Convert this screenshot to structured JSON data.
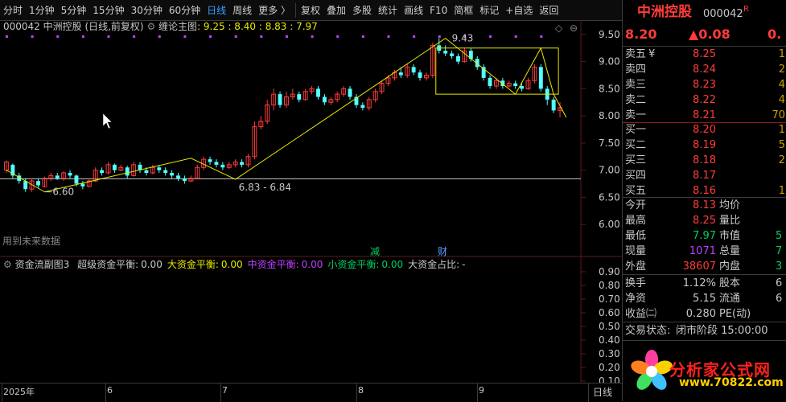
{
  "toolbar": {
    "items": [
      "分时",
      "1分钟",
      "5分钟",
      "15分钟",
      "30分钟",
      "60分钟",
      "日线",
      "周线",
      "更多 〉",
      "复权",
      "叠加",
      "多股",
      "统计",
      "画线",
      "F10",
      "简框",
      "标记",
      "+自选",
      "返回"
    ],
    "selected": "日线"
  },
  "main_legend": {
    "code_name": "000042 中洲控股 (日线,前复权)",
    "indicator": "缠论主图",
    "values": ": 9.25 : 8.40 : 8.83 : 7.97"
  },
  "sub_legend": {
    "name": "资金流副图3",
    "items": [
      {
        "label": "超级资金平衡:",
        "value": "0.00",
        "color": "#c8c8c8"
      },
      {
        "label": "大资金平衡:",
        "value": "0.00",
        "color": "#e8e800"
      },
      {
        "label": "中资金平衡:",
        "value": "0.00",
        "color": "#c040ff"
      },
      {
        "label": "小资金平衡:",
        "value": "0.00",
        "color": "#00d060"
      },
      {
        "label": "大资金占比:",
        "value": "-",
        "color": "#c8c8c8"
      }
    ]
  },
  "future_note": "用到未来数据",
  "markers": {
    "jian": "减",
    "cai": "财"
  },
  "chart_data": {
    "type": "candlestick",
    "ylim": [
      5.75,
      9.75
    ],
    "yticks": [
      "9.50",
      "9.00",
      "8.50",
      "8.00",
      "7.50",
      "7.00",
      "6.50",
      "6.00"
    ],
    "xticks": [
      "2025年",
      "6",
      "7",
      "8",
      "9"
    ],
    "low_label": "6.60",
    "mid_label": "6.83 - 6.84",
    "high_label": "9.43",
    "ref_line": 6.84,
    "candles": [
      [
        7.0,
        7.15,
        6.95,
        7.18
      ],
      [
        7.1,
        6.9,
        6.85,
        7.12
      ],
      [
        6.9,
        6.8,
        6.75,
        6.95
      ],
      [
        6.8,
        6.65,
        6.6,
        6.85
      ],
      [
        6.65,
        6.8,
        6.6,
        6.85
      ],
      [
        6.8,
        6.72,
        6.68,
        6.85
      ],
      [
        6.7,
        6.85,
        6.68,
        6.88
      ],
      [
        6.85,
        6.9,
        6.8,
        6.95
      ],
      [
        6.9,
        6.85,
        6.82,
        6.95
      ],
      [
        6.85,
        6.95,
        6.8,
        6.98
      ],
      [
        6.95,
        6.9,
        6.85,
        7.0
      ],
      [
        6.9,
        6.75,
        6.7,
        6.92
      ],
      [
        6.75,
        6.7,
        6.65,
        6.8
      ],
      [
        6.7,
        6.8,
        6.68,
        6.85
      ],
      [
        6.8,
        7.0,
        6.78,
        7.05
      ],
      [
        7.0,
        6.95,
        6.9,
        7.05
      ],
      [
        6.95,
        7.1,
        6.92,
        7.15
      ],
      [
        7.1,
        7.0,
        6.95,
        7.12
      ],
      [
        7.0,
        7.05,
        6.98,
        7.1
      ],
      [
        7.05,
        6.9,
        6.85,
        7.08
      ],
      [
        6.9,
        7.1,
        6.88,
        7.15
      ],
      [
        7.1,
        7.0,
        6.95,
        7.15
      ],
      [
        7.0,
        6.95,
        6.9,
        7.05
      ],
      [
        6.95,
        7.05,
        6.92,
        7.1
      ],
      [
        7.05,
        7.0,
        6.95,
        7.1
      ],
      [
        7.0,
        6.95,
        6.9,
        7.05
      ],
      [
        6.95,
        6.9,
        6.85,
        7.0
      ],
      [
        6.9,
        6.85,
        6.8,
        6.95
      ],
      [
        6.85,
        6.8,
        6.75,
        6.9
      ],
      [
        6.8,
        6.85,
        6.78,
        6.9
      ],
      [
        6.85,
        7.05,
        6.83,
        7.1
      ],
      [
        7.05,
        7.2,
        7.0,
        7.25
      ],
      [
        7.2,
        7.15,
        7.1,
        7.25
      ],
      [
        7.15,
        7.1,
        7.05,
        7.2
      ],
      [
        7.1,
        7.05,
        7.0,
        7.15
      ],
      [
        7.05,
        7.1,
        7.02,
        7.15
      ],
      [
        7.1,
        7.15,
        7.05,
        7.2
      ],
      [
        7.15,
        7.1,
        7.05,
        7.2
      ],
      [
        7.1,
        7.25,
        7.05,
        7.3
      ],
      [
        7.25,
        7.8,
        7.2,
        7.9
      ],
      [
        7.8,
        7.9,
        7.75,
        8.0
      ],
      [
        7.9,
        8.2,
        7.85,
        8.3
      ],
      [
        8.2,
        8.4,
        8.1,
        8.5
      ],
      [
        8.4,
        8.2,
        8.15,
        8.45
      ],
      [
        8.2,
        8.35,
        8.15,
        8.45
      ],
      [
        8.35,
        8.4,
        8.3,
        8.5
      ],
      [
        8.4,
        8.3,
        8.25,
        8.45
      ],
      [
        8.3,
        8.45,
        8.28,
        8.5
      ],
      [
        8.45,
        8.5,
        8.4,
        8.55
      ],
      [
        8.5,
        8.35,
        8.3,
        8.55
      ],
      [
        8.35,
        8.25,
        8.2,
        8.4
      ],
      [
        8.25,
        8.3,
        8.2,
        8.35
      ],
      [
        8.3,
        8.4,
        8.25,
        8.45
      ],
      [
        8.4,
        8.5,
        8.35,
        8.55
      ],
      [
        8.5,
        8.35,
        8.3,
        8.55
      ],
      [
        8.35,
        8.2,
        8.15,
        8.4
      ],
      [
        8.2,
        8.15,
        8.1,
        8.25
      ],
      [
        8.15,
        8.3,
        8.1,
        8.35
      ],
      [
        8.3,
        8.45,
        8.25,
        8.5
      ],
      [
        8.45,
        8.6,
        8.4,
        8.65
      ],
      [
        8.6,
        8.7,
        8.55,
        8.75
      ],
      [
        8.7,
        8.8,
        8.65,
        8.85
      ],
      [
        8.8,
        8.75,
        8.7,
        8.9
      ],
      [
        8.75,
        8.9,
        8.7,
        8.95
      ],
      [
        8.9,
        8.8,
        8.75,
        8.95
      ],
      [
        8.8,
        8.7,
        8.65,
        8.85
      ],
      [
        8.7,
        8.75,
        8.65,
        8.8
      ],
      [
        8.75,
        9.3,
        8.7,
        9.35
      ],
      [
        9.3,
        9.2,
        9.15,
        9.43
      ],
      [
        9.2,
        9.15,
        9.1,
        9.3
      ],
      [
        9.15,
        9.1,
        9.05,
        9.2
      ],
      [
        9.1,
        9.0,
        8.95,
        9.15
      ],
      [
        9.0,
        9.2,
        8.98,
        9.25
      ],
      [
        9.2,
        9.05,
        9.0,
        9.25
      ],
      [
        9.05,
        8.9,
        8.85,
        9.1
      ],
      [
        8.9,
        8.7,
        8.65,
        8.95
      ],
      [
        8.7,
        8.55,
        8.5,
        8.75
      ],
      [
        8.55,
        8.65,
        8.5,
        8.7
      ],
      [
        8.65,
        8.55,
        8.5,
        8.7
      ],
      [
        8.55,
        8.6,
        8.52,
        8.65
      ],
      [
        8.6,
        8.55,
        8.5,
        8.65
      ],
      [
        8.55,
        8.5,
        8.45,
        8.6
      ],
      [
        8.5,
        8.65,
        8.48,
        8.7
      ],
      [
        8.65,
        8.9,
        8.6,
        8.95
      ],
      [
        8.9,
        8.5,
        8.45,
        8.95
      ],
      [
        8.5,
        8.3,
        8.2,
        8.55
      ],
      [
        8.3,
        8.1,
        8.05,
        8.35
      ],
      [
        8.1,
        8.15,
        7.97,
        8.25
      ]
    ],
    "box1": {
      "i0": 68,
      "i1": 86,
      "ytop": 9.25,
      "ybot": 8.4
    },
    "zigzag": [
      [
        0,
        7.0
      ],
      [
        6,
        6.6
      ],
      [
        29,
        7.22
      ],
      [
        36,
        6.83
      ],
      [
        69,
        9.43
      ],
      [
        80,
        8.4
      ],
      [
        84,
        9.25
      ],
      [
        86,
        8.4
      ],
      [
        88,
        7.97
      ]
    ]
  },
  "quote": {
    "name": "中洲控股",
    "code": "000042",
    "r_mark": "R",
    "price": "8.20",
    "change": "▲0.08",
    "change2": "0.",
    "asks": [
      {
        "label": "卖五",
        "price": "8.25",
        "vol": "1"
      },
      {
        "label": "卖四",
        "price": "8.24",
        "vol": "2"
      },
      {
        "label": "卖三",
        "price": "8.23",
        "vol": "4"
      },
      {
        "label": "卖二",
        "price": "8.22",
        "vol": "4"
      },
      {
        "label": "卖一",
        "price": "8.21",
        "vol": "70"
      }
    ],
    "yen": "¥",
    "bids": [
      {
        "label": "买一",
        "price": "8.20",
        "vol": "1"
      },
      {
        "label": "买二",
        "price": "8.19",
        "vol": "5"
      },
      {
        "label": "买三",
        "price": "8.18",
        "vol": "2"
      },
      {
        "label": "买四",
        "price": "8.17",
        "vol": ""
      },
      {
        "label": "买五",
        "price": "8.16",
        "vol": "1"
      }
    ],
    "stats": [
      {
        "l1": "今开",
        "v1": "8.13",
        "c1": "red",
        "l2": "均价",
        "v2": ""
      },
      {
        "l1": "最高",
        "v1": "8.25",
        "c1": "red",
        "l2": "量比",
        "v2": ""
      },
      {
        "l1": "最低",
        "v1": "7.97",
        "c1": "green",
        "l2": "市值",
        "v2": "5"
      },
      {
        "l1": "现量",
        "v1": "1071",
        "c1": "purple",
        "l2": "总量",
        "v2": "7"
      },
      {
        "l1": "外盘",
        "v1": "38607",
        "c1": "red",
        "l2": "内盘",
        "v2": "3"
      }
    ],
    "stats2": [
      {
        "l1": "换手",
        "v1": "1.12%",
        "l2": "股本",
        "v2": "6"
      },
      {
        "l1": "净资",
        "v1": "5.15",
        "l2": "流通",
        "v2": "6"
      },
      {
        "l1": "收益㈡",
        "v1": "0.280",
        "l2": "PE(动)",
        "v2": ""
      }
    ],
    "status_label": "交易状态:",
    "status_value": "闭市阶段 15:00:00"
  },
  "sub_yticks": [
    "0.90",
    "0.80",
    "0.70",
    "0.60",
    "0.50",
    "0.40",
    "0.30",
    "0.20",
    "0.10"
  ],
  "bottom": {
    "period": "日线"
  },
  "watermark": {
    "text": "分析家公式网",
    "url": "www.70822.com"
  }
}
